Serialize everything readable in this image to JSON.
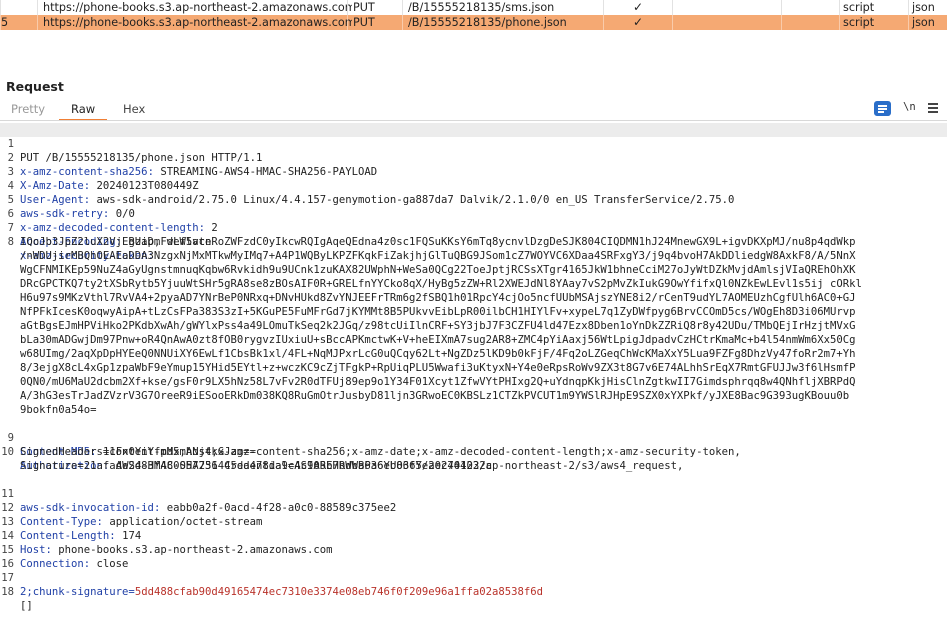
{
  "history": {
    "rows": [
      {
        "num": "",
        "url": "https://phone-books.s3.ap-northeast-2.amazonaws.com",
        "method": "PUT",
        "path": "/B/15555218135/sms.json",
        "check": "✓",
        "mime": "script",
        "ext": "json"
      },
      {
        "num": "5",
        "url": "https://phone-books.s3.ap-northeast-2.amazonaws.com",
        "method": "PUT",
        "path": "/B/15555218135/phone.json",
        "check": "✓",
        "mime": "script",
        "ext": "json"
      }
    ]
  },
  "request": {
    "title": "Request",
    "tabs": {
      "pretty": "Pretty",
      "raw": "Raw",
      "hex": "Hex"
    },
    "newline_toggle": "\\n",
    "lines": [
      {
        "n": "1",
        "text": "PUT /B/15555218135/phone.json HTTP/1.1"
      },
      {
        "n": "2",
        "key": "x-amz-content-sha256",
        "val": "STREAMING-AWS4-HMAC-SHA256-PAYLOAD"
      },
      {
        "n": "3",
        "key": "X-Amz-Date",
        "val": "20240123T080449Z"
      },
      {
        "n": "4",
        "key": "User-Agent",
        "val": "aws-sdk-android/2.75.0 Linux/4.4.157-genymotion-ga887da7 Dalvik/2.1.0/0 en_US TransferService/2.75.0"
      },
      {
        "n": "5",
        "key": "aws-sdk-retry",
        "val": "0/0"
      },
      {
        "n": "6",
        "key": "x-amz-decoded-content-length",
        "val": "2"
      },
      {
        "n": "7",
        "key": "Accept-Encoding",
        "val": "gzip, deflate"
      },
      {
        "n": "8",
        "key": "x-amz-security-token",
        "val": "",
        "cont": [
          "IQoJb3JpZ2luX2VjEBUaDmFwLW5vcnRoZWFzdC0yIkcwRQIgAqeQEdna4z0sc1FQSuKKsY6mTq8ycnvlDzgDeSJK804CIQDMN1hJ24MnewGX9L+igvDKXpMJ/nu8p4qdWkp",
          "/nWDUjirMBQhOEAEaDDA3NzgxNjMxMTkwMyIMq7+A4P1WQByLKPZFKqkFiZakjhjGlTuQBG9JSom1cZ7WOYVC6XDaa4SRFxgY3/j9q4bvoH7AkDDliedgW8AxkF8/A/5NnX",
          "WgCFNMIKEp59NuZ4aGyUgnstmnuqKqbw6Rvkidh9u9UCnk1zuKAX82UWphN+WeSa0QCg22ToeJptjRCSsXTgr4165JkW1bhneCciM27oJyWtDZkMvjdAmlsjVIaQREhOhXK",
          "DRcGPCTKQ7ty2tXSbRytb5YjuuWtSHr5gRA8se8zBOsAIF0R+GRELfnYYCko8qX/HyBg5zZW+Rl2XWEJdNl8YAay7vS2pMvZkIukG9OwYfifxQl0NZkEwLEvl1s5ij cORkl",
          "H6u97s9MKzVthl7RvVA4+2pyaAD7YNrBeP0NRxq+DNvHUkd8ZvYNJEEFrTRm6g2fSBQ1h01RpcY4cjOo5ncfUUbMSAjszYNE8i2/rCenT9udYL7AOMEUzhCgfUlh6AC0+GJ",
          "NfPFkIcesK0oqwyAipA+tLzCsFPa383S3zI+5KGuPE5FuMFrGd7jKYMMt8B5PUkvvEibLpR00ilbCH1HIYlFv+xypeL7q1ZyDWfpyg6BrvCCOmD5cs/WOgEh8D3i06MUrvp",
          "aGtBgsEJmHPViHko2PKdbXwAh/gWYlxPss4a49LOmuTkSeq2k2JGq/z98tcUiIlnCRF+SY3jbJ7F3CZFU4ld47Ezx8Dben1oYnDkZZRiQ8r8y42UDu/TMbQEjIrHzjtMVxG",
          "bLa30mADGwjDm97Pnw+oR4QnAwA0zt8fOB0rygvzIUxiuU+sBccAPKmctwK+V+heEIXmA7sug2AR8+ZMC4pYiAaxj56WtLpigJdpadvCzHCtrKmaMc+b4l54nmWm6Xx50Cg",
          "w68UImg/2aqXpDpHYEeQ0NNUiXY6EwLf1CbsBk1xl/4FL+NqMJPxrLcG0uQCqy62Lt+NgZDz5lKD9b0kFjF/4Fq2oLZGeqChWcKMaXxY5Lua9FZFg8DhzVy47foRr2m7+Yh",
          "8/3ejgX8cL4xGp1zpaWbF9eYmup15YHid5EYtl+z+wczKC9cZjTFgkP+RpUiqPLU5Wwafi3uKtyxN+Y4e0eRpsRoWv9ZX3t8G7v6E74ALhhSrEqX7RmtGFUJJw3f6lHsmfP",
          "0QN0/mU6MaU2dcbm2Xf+kse/gsF0r9LX5hNz58L7vFv2R0dTFUj89ep9o1Y34F01Xcyt1ZfwVYtPHIxg2Q+uYdnqpKkjHisClnZgtkwII7Gimdsphrqq8w4QNhfljXBRPdQ",
          "A/3hG3esTrJadZVzrV3G7OreeR9iESooERkDm038KQ8RuGmOtrJusbyD81ljn3GRwoEC0KBSLz1CTZkPVCUT1m9YWSlRJHpE9SZX0xYXPkf/yJXE8Bac9G393ugKBouu0b",
          "9bokfn0a54o="
        ]
      },
      {
        "n": "9",
        "key": "Content-MD5",
        "val": "11Fx0YiYfpMxmANj4kGJzg=="
      },
      {
        "n": "10",
        "key": "Authorization",
        "val": "AWS4-HMAC-SHA256 Credential=ASIAREHRWWBP36YUO36Y/20240123/ap-northeast-2/s3/aws4_request,",
        "cont": [
          "SignedHeaders=content-md5;host;x-amz-content-sha256;x-amz-date;x-amz-decoded-content-length;x-amz-security-token,",
          "Signature=21afade2d83f480057731445da478da9c4c905b7bdba6a6eb86f5eaec744022c"
        ]
      },
      {
        "n": "11",
        "key": "aws-sdk-invocation-id",
        "val": "eabb0a2f-0acd-4f28-a0c0-88589c375ee2"
      },
      {
        "n": "12",
        "key": "Content-Type",
        "val": "application/octet-stream"
      },
      {
        "n": "13",
        "key": "Content-Length",
        "val": "174"
      },
      {
        "n": "14",
        "key": "Host",
        "val": "phone-books.s3.ap-northeast-2.amazonaws.com"
      },
      {
        "n": "15",
        "key": "Connection",
        "val": "close"
      },
      {
        "n": "16",
        "text": ""
      },
      {
        "n": "17",
        "chunk": "2;chunk-signature=",
        "sig": "5dd488cfab90d49165474ec7310e3374e08eb746f0f209e96a1ffa02a8538f6d"
      },
      {
        "n": "18",
        "text": "[]"
      }
    ]
  }
}
